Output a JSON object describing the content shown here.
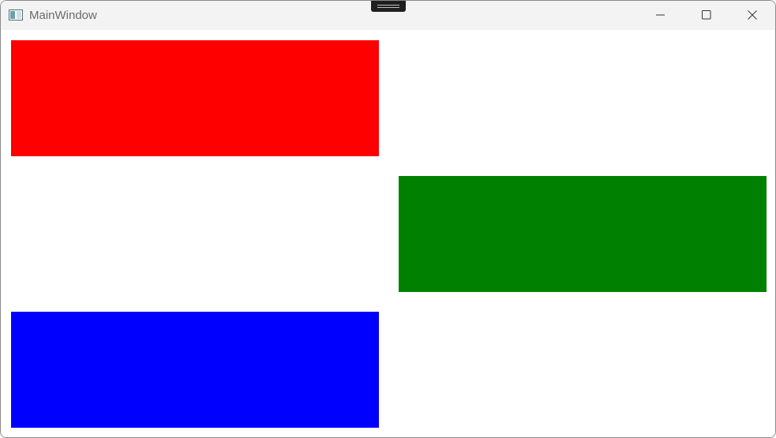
{
  "window": {
    "title": "MainWindow",
    "icon": "app-window-icon"
  },
  "caption_buttons": {
    "minimize": "minimize-icon",
    "maximize": "maximize-icon",
    "close": "close-icon"
  },
  "rectangles": [
    {
      "name": "red-rectangle",
      "color": "#ff0000"
    },
    {
      "name": "green-rectangle",
      "color": "#008000"
    },
    {
      "name": "blue-rectangle",
      "color": "#0000ff"
    }
  ]
}
